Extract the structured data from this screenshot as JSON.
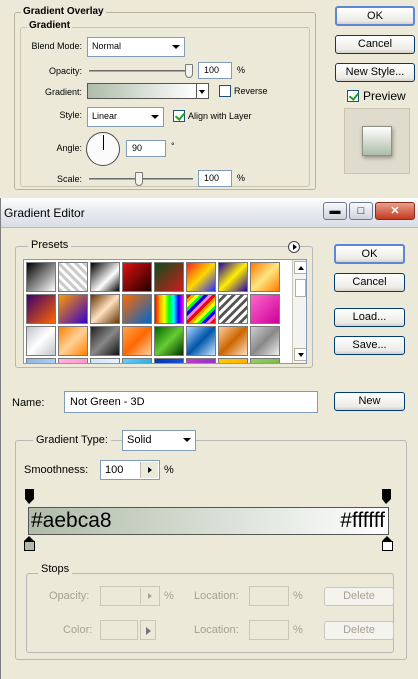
{
  "layer_style": {
    "group_title": "Gradient Overlay",
    "subgroup_title": "Gradient",
    "blend_mode_label": "Blend Mode:",
    "blend_mode_value": "Normal",
    "opacity_label": "Opacity:",
    "opacity_value": "100",
    "opacity_unit": "%",
    "opacity_level": 1.0,
    "gradient_label": "Gradient:",
    "reverse_label": "Reverse",
    "reverse_checked": false,
    "style_label": "Style:",
    "style_value": "Linear",
    "align_label": "Align with Layer",
    "align_checked": true,
    "angle_label": "Angle:",
    "angle_value": "90",
    "angle_unit": "°",
    "scale_label": "Scale:",
    "scale_value": "100",
    "scale_unit": "%",
    "scale_level": 0.5,
    "ok_label": "OK",
    "cancel_label": "Cancel",
    "new_style_label": "New Style...",
    "preview_label": "Preview",
    "preview_checked": true
  },
  "gradient_editor": {
    "title": "Gradient Editor",
    "presets_label": "Presets",
    "ok_label": "OK",
    "cancel_label": "Cancel",
    "load_label": "Load...",
    "save_label": "Save...",
    "name_label": "Name:",
    "name_value": "Not Green - 3D",
    "new_label": "New",
    "gradient_type_label": "Gradient Type:",
    "gradient_type_value": "Solid",
    "smoothness_label": "Smoothness:",
    "smoothness_value": "100",
    "smoothness_unit": "%",
    "color_start": "#aebca8",
    "color_end": "#ffffff",
    "bar_label_left": "#aebca8",
    "bar_label_right": "#ffffff",
    "stops": {
      "legend": "Stops",
      "opacity_label": "Opacity:",
      "opacity_unit": "%",
      "location_label": "Location:",
      "location_unit": "%",
      "delete_label": "Delete",
      "color_label": "Color:"
    }
  },
  "presets": [
    "linear-gradient(135deg,#000,#fff)",
    "repeating-linear-gradient(45deg,#ccc 0 3px,#fff 3px 6px)",
    "linear-gradient(135deg,#000,#fff 60%,#000)",
    "linear-gradient(135deg,#e01010,#200000)",
    "linear-gradient(135deg,#0b4d1c,#d21c1c)",
    "linear-gradient(135deg,#ff2020,#ffd800,#2030ff)",
    "linear-gradient(135deg,#2200aa,#ffee00,#2200aa)",
    "linear-gradient(135deg,#ff7a00,#ffe680,#ff7a00)",
    "linear-gradient(135deg,#3a0070,#ff6600)",
    "linear-gradient(135deg,#ff9900,#3300cc)",
    "linear-gradient(135deg,#663300,#ffe0c0,#663300)",
    "linear-gradient(135deg,#ff6a00,#0066cc)",
    "linear-gradient(90deg,red,orange,yellow,lime,cyan,blue,magenta)",
    "repeating-linear-gradient(135deg,red 0 3px,orange 3px 6px,yellow 6px 9px,lime 9px 12px,blue 12px 15px,violet 15px 18px)",
    "repeating-linear-gradient(135deg,#fff 0 3px,#555 3px 6px)",
    "linear-gradient(135deg,#ff66cc,#cc0099)",
    "linear-gradient(135deg,#bfc4cc,#ffffff,#bfc4cc)",
    "linear-gradient(135deg,#ff8000,#ffd199,#ff8000)",
    "linear-gradient(135deg,#222,#888,#111)",
    "linear-gradient(135deg,#ffa64d,#ff6600,#ffd1a3)",
    "linear-gradient(135deg,#006600,#66cc33,#003300)",
    "linear-gradient(135deg,#aad4ff,#0055aa,#cce6ff)",
    "linear-gradient(135deg,#ffcc99,#cc6600,#ffe0c0)",
    "linear-gradient(135deg,#d0d0d0,#888,#f0f0f0)",
    "linear-gradient(135deg,#8ab4e8,#cce0ff)",
    "linear-gradient(135deg,#ffb3e0,#ff80c0)",
    "linear-gradient(135deg,#c9e4ff,#fff)",
    "linear-gradient(135deg,#66ccff,#0099cc)",
    "linear-gradient(135deg,#0033aa,#3366ff)",
    "linear-gradient(135deg,#cc33cc,#6633cc)",
    "linear-gradient(135deg,#ffcc00,#ff9900)",
    "linear-gradient(135deg,#99cc66,#66aa33)"
  ]
}
